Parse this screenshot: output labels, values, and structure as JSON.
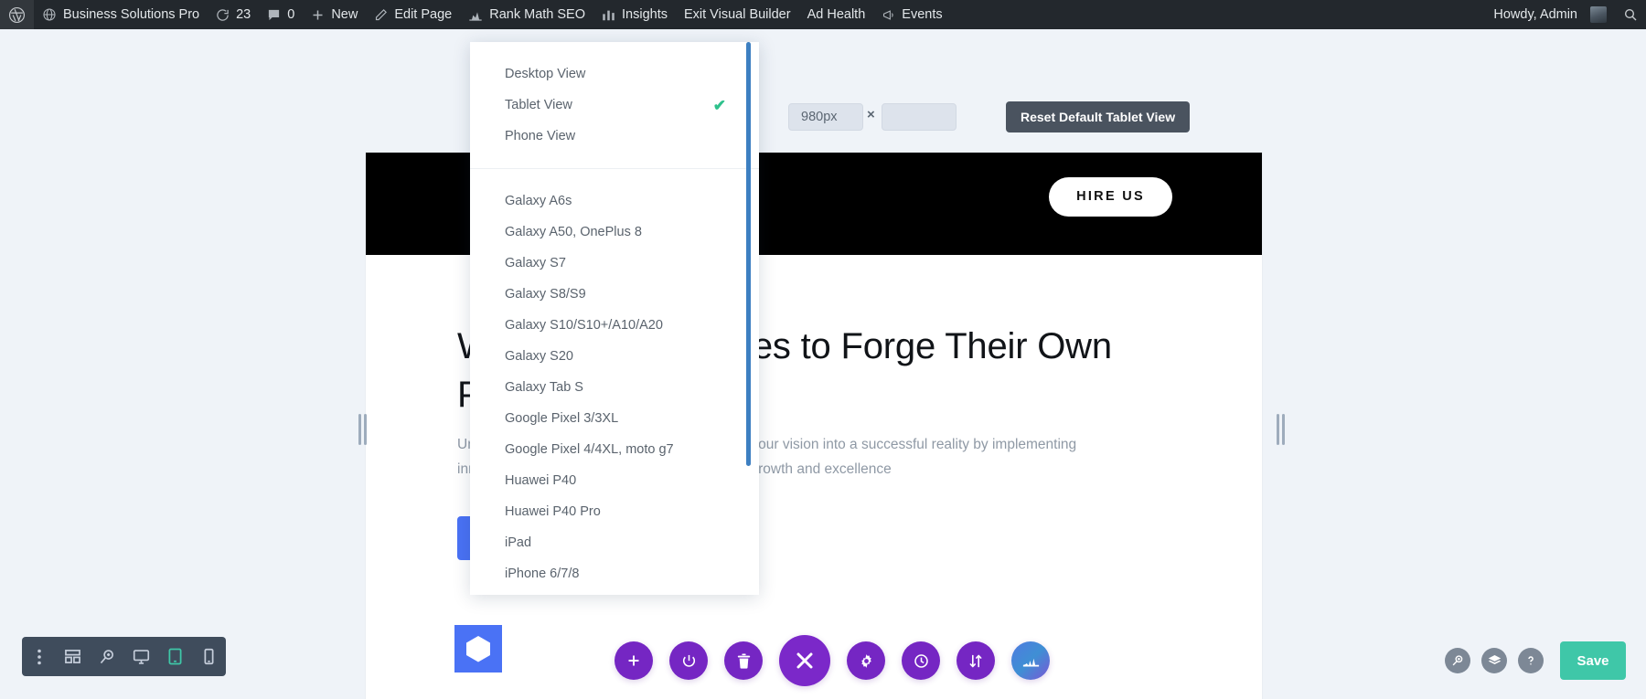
{
  "adminbar": {
    "left_items": [
      {
        "label": "",
        "icon": "wordpress-logo-icon"
      },
      {
        "label": "Business Solutions Pro",
        "icon": "site-icon"
      },
      {
        "label": "23",
        "icon": "updates-icon"
      },
      {
        "label": "0",
        "icon": "comments-icon"
      },
      {
        "label": "New",
        "icon": "plus-icon"
      },
      {
        "label": "Edit Page",
        "icon": "pencil-icon"
      },
      {
        "label": "Rank Math SEO",
        "icon": "rankmath-icon"
      },
      {
        "label": "Insights",
        "icon": "bar-chart-icon"
      },
      {
        "label": "Exit Visual Builder",
        "icon": ""
      },
      {
        "label": "Ad Health",
        "icon": ""
      },
      {
        "label": "Events",
        "icon": "megaphone-icon"
      }
    ],
    "howdy": "Howdy, Admin",
    "search_icon": "search-icon"
  },
  "size_row": {
    "width_value": "980px",
    "height_value": "",
    "height_placeholder": "",
    "separator": "×",
    "reset_label": "Reset Default Tablet View"
  },
  "device_menu": {
    "views": [
      {
        "label": "Desktop View",
        "checked": false
      },
      {
        "label": "Tablet View",
        "checked": true
      },
      {
        "label": "Phone View",
        "checked": false
      }
    ],
    "check_glyph": "✔",
    "devices": [
      "Galaxy A6s",
      "Galaxy A50, OnePlus 8",
      "Galaxy S7",
      "Galaxy S8/S9",
      "Galaxy S10/S10+/A10/A20",
      "Galaxy S20",
      "Galaxy Tab S",
      "Google Pixel 3/3XL",
      "Google Pixel 4/4XL, moto g7",
      "Huawei P40",
      "Huawei P40 Pro",
      "iPad",
      "iPhone 6/7/8"
    ]
  },
  "canvas": {
    "hire_us_label": "HIRE US",
    "heading": "We Help Businesses to Forge Their Own Path",
    "paragraph": "Unlock the full potential of your business. Turn your vision into a successful reality by implementing innovative strategies and fostering a culture of growth and excellence",
    "cta_label": ""
  },
  "viewport_toolbar": {
    "buttons": [
      {
        "name": "more-options-icon",
        "active": false
      },
      {
        "name": "layout-grid-icon",
        "active": false
      },
      {
        "name": "zoom-search-icon",
        "active": false
      },
      {
        "name": "desktop-icon",
        "active": false
      },
      {
        "name": "tablet-icon",
        "active": true
      },
      {
        "name": "phone-icon",
        "active": false
      }
    ]
  },
  "round_buttons": [
    {
      "name": "add-icon",
      "glyph": "+"
    },
    {
      "name": "power-icon",
      "glyph": "⏻"
    },
    {
      "name": "trash-icon",
      "glyph": "🗑"
    },
    {
      "name": "close-icon",
      "glyph": "✕"
    },
    {
      "name": "settings-gear-icon",
      "glyph": "✹"
    },
    {
      "name": "history-clock-icon",
      "glyph": "🕑"
    },
    {
      "name": "reorder-arrows-icon",
      "glyph": "⇅"
    },
    {
      "name": "stats-chart-icon",
      "glyph": "📊"
    }
  ],
  "right_controls": {
    "circles": [
      {
        "name": "zoom-search-icon"
      },
      {
        "name": "layers-icon"
      },
      {
        "name": "help-icon"
      }
    ],
    "save_label": "Save"
  },
  "colors": {
    "admin_bar": "#23282d",
    "accent_purple": "#7526c3",
    "save_green": "#3fc7a8",
    "check_green": "#2fc18c",
    "scrollbar_blue": "#3d7fc1",
    "cta_blue": "#4a72f5",
    "reset_slate": "#4a535f"
  }
}
